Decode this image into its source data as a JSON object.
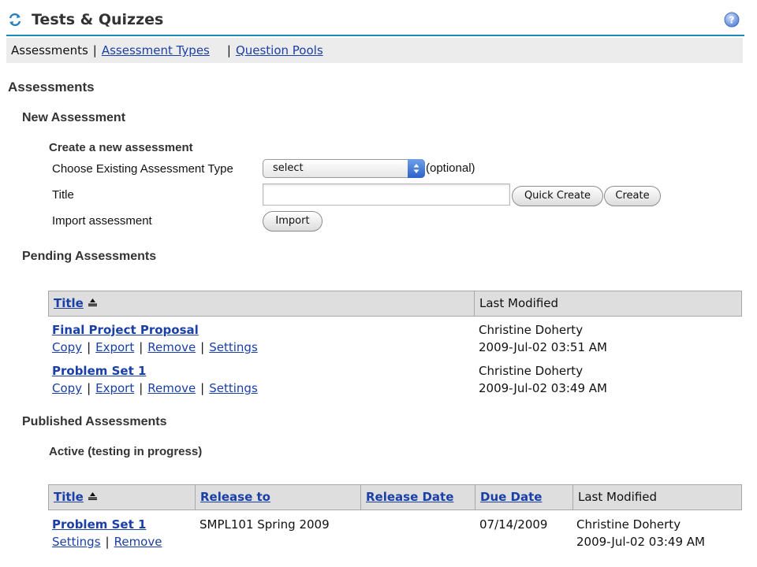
{
  "header": {
    "title": "Tests & Quizzes",
    "tool_icon": "reset-icon",
    "help_icon": "help-icon"
  },
  "nav": {
    "current": "Assessments",
    "separator": "|",
    "links": [
      "Assessment Types",
      "Question Pools"
    ]
  },
  "page_heading": "Assessments",
  "new_assessment": {
    "heading": "New Assessment",
    "subheading": "Create a new assessment",
    "type_label": "Choose Existing Assessment Type",
    "type_value": "select",
    "type_suffix": "(optional)",
    "title_label": "Title",
    "title_value": "",
    "quick_create": "Quick Create",
    "create": "Create",
    "import_label": "Import assessment",
    "import_button": "Import"
  },
  "pending": {
    "heading": "Pending Assessments",
    "columns": [
      "Title",
      "Last Modified"
    ],
    "rows": [
      {
        "title": "Final Project Proposal",
        "actions": [
          "Copy",
          "Export",
          "Remove",
          "Settings"
        ],
        "modified_by": "Christine Doherty",
        "modified_at": "2009-Jul-02 03:51 AM"
      },
      {
        "title": "Problem Set 1",
        "actions": [
          "Copy",
          "Export",
          "Remove",
          "Settings"
        ],
        "modified_by": "Christine Doherty",
        "modified_at": "2009-Jul-02 03:49 AM"
      }
    ]
  },
  "published": {
    "heading": "Published Assessments",
    "active_heading": "Active (testing in progress)",
    "columns": [
      "Title",
      "Release to",
      "Release Date",
      "Due Date",
      "Last Modified"
    ],
    "rows": [
      {
        "title": "Problem Set 1",
        "actions": [
          "Settings",
          "Remove"
        ],
        "release_to": "SMPL101 Spring 2009",
        "release_date": "",
        "due_date": "07/14/2009",
        "modified_by": "Christine Doherty",
        "modified_at": "2009-Jul-02 03:49 AM"
      }
    ]
  },
  "colors": {
    "link": "#1a3fa6",
    "header_rule": "#1e8ab8",
    "nav_bg": "#ececec",
    "table_header_bg": "#dedede"
  }
}
